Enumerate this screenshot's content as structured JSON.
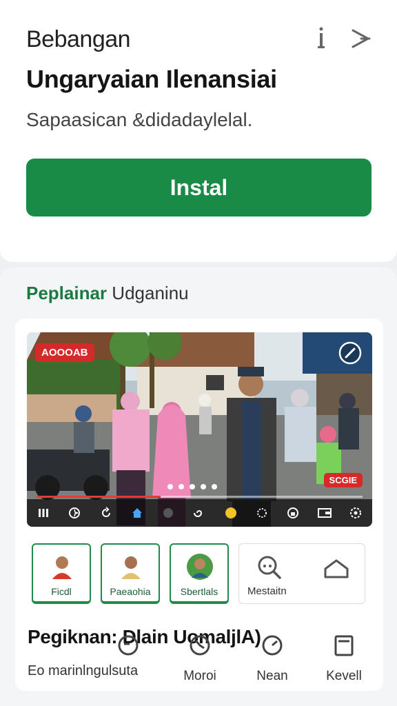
{
  "header": {
    "kicker": "Bebangan",
    "icons": [
      "info-icon",
      "close-arrow-icon"
    ]
  },
  "app": {
    "title": "Ungaryaian Ilenansiai",
    "subtitle": "Sapaasican &didadaylelal.",
    "install_label": "Instal"
  },
  "section": {
    "title_green": "Peplainar",
    "title_rest": "Udganinu"
  },
  "video": {
    "rec_badge": "AOOOAB",
    "speed_badge": "SCGIE",
    "progress": 0.38,
    "controls": [
      "bars-icon",
      "sparkle-icon",
      "replay-icon",
      "home-icon",
      "circle-icon",
      "swirl-icon",
      "yellow-dot-icon",
      "settings-dots-icon",
      "lock-icon",
      "wallet-icon",
      "gear-icon"
    ]
  },
  "chips": [
    {
      "label": "Ficdl",
      "icon": "person-red-icon"
    },
    {
      "label": "Paeaohia",
      "icon": "person-yellow-icon"
    },
    {
      "label": "Sbertlals",
      "icon": "person-green-icon"
    }
  ],
  "chip_plain": {
    "label": "Mestaitn",
    "icons": [
      "search-icon",
      "home-outline-icon"
    ]
  },
  "promo": {
    "title": "Pegiknan: Dlain UomaljlA)",
    "subtitle": "Eo marinlngulsuta"
  },
  "nav": [
    {
      "label": "",
      "icon": "dial-icon"
    },
    {
      "label": "Moroi",
      "icon": "clock-icon"
    },
    {
      "label": "Nean",
      "icon": "gauge-icon"
    },
    {
      "label": "Kevell",
      "icon": "tablet-icon"
    }
  ],
  "colors": {
    "accent": "#1a8a47",
    "badge": "#d42a2a"
  }
}
